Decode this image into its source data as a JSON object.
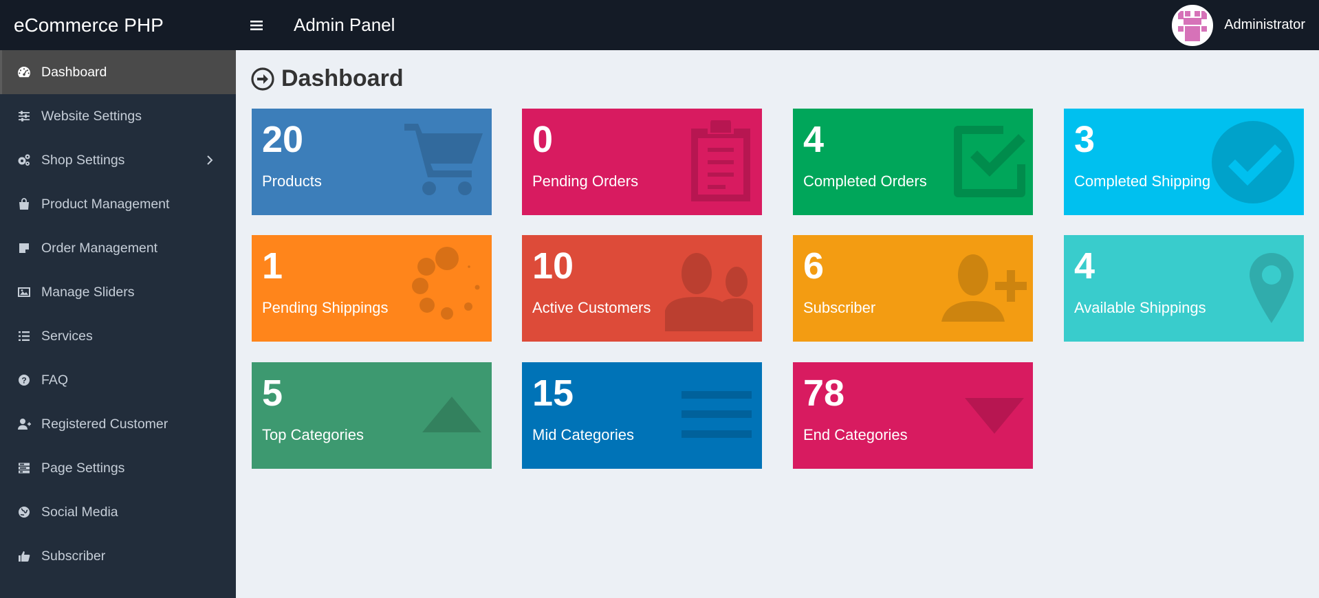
{
  "header": {
    "logo": "eCommerce PHP",
    "panel_title": "Admin Panel",
    "username": "Administrator"
  },
  "sidebar": {
    "items": [
      {
        "label": "Dashboard",
        "icon": "dashboard-icon",
        "active": true
      },
      {
        "label": "Website Settings",
        "icon": "sliders-icon"
      },
      {
        "label": "Shop Settings",
        "icon": "gears-icon",
        "has_submenu": true
      },
      {
        "label": "Product Management",
        "icon": "shopping-bag-icon"
      },
      {
        "label": "Order Management",
        "icon": "sticky-note-icon"
      },
      {
        "label": "Manage Sliders",
        "icon": "picture-icon"
      },
      {
        "label": "Services",
        "icon": "list-icon"
      },
      {
        "label": "FAQ",
        "icon": "question-circle-icon"
      },
      {
        "label": "Registered Customer",
        "icon": "user-plus-icon"
      },
      {
        "label": "Page Settings",
        "icon": "tasks-icon"
      },
      {
        "label": "Social Media",
        "icon": "globe-icon"
      },
      {
        "label": "Subscriber",
        "icon": "hand-pointer-icon"
      }
    ]
  },
  "page": {
    "title": "Dashboard"
  },
  "stats": [
    {
      "value": "20",
      "label": "Products",
      "color": "#3c7eba",
      "icon": "cart-icon"
    },
    {
      "value": "0",
      "label": "Pending Orders",
      "color": "#d81b60",
      "icon": "clipboard-icon"
    },
    {
      "value": "4",
      "label": "Completed Orders",
      "color": "#00a65a",
      "icon": "check-square-icon"
    },
    {
      "value": "3",
      "label": "Completed Shipping",
      "color": "#00c0ef",
      "icon": "check-circle-icon"
    },
    {
      "value": "1",
      "label": "Pending Shippings",
      "color": "#ff851b",
      "icon": "spinner-icon"
    },
    {
      "value": "10",
      "label": "Active Customers",
      "color": "#dd4b39",
      "icon": "users-icon"
    },
    {
      "value": "6",
      "label": "Subscriber",
      "color": "#f39c12",
      "icon": "user-plus-icon"
    },
    {
      "value": "4",
      "label": "Available Shippings",
      "color": "#39cccc",
      "icon": "map-marker-icon"
    },
    {
      "value": "5",
      "label": "Top Categories",
      "color": "#3d9970",
      "icon": "arrow-up-icon"
    },
    {
      "value": "15",
      "label": "Mid Categories",
      "color": "#0073b7",
      "icon": "bars-icon"
    },
    {
      "value": "78",
      "label": "End Categories",
      "color": "#d81b60",
      "icon": "arrow-down-icon"
    }
  ]
}
